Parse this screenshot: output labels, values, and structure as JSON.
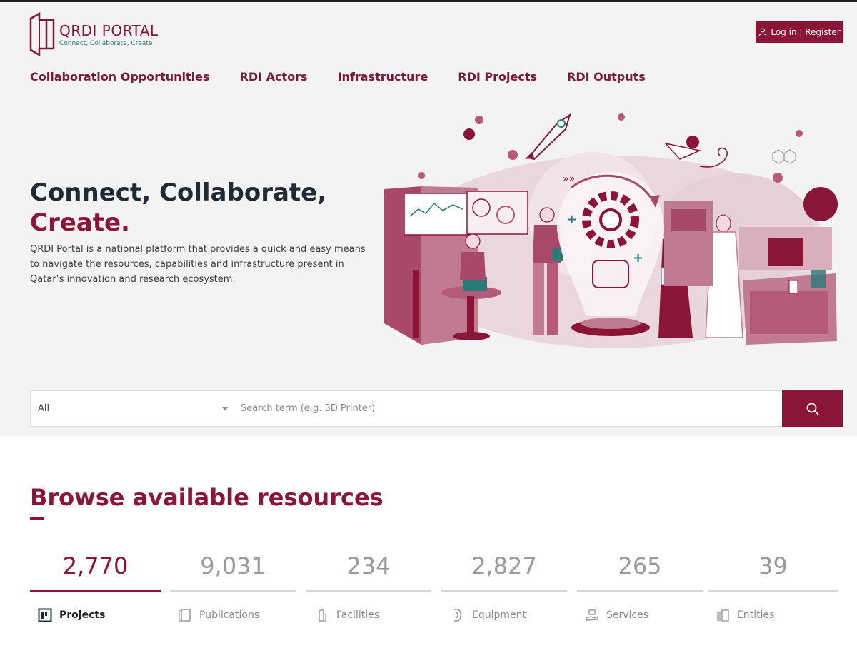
{
  "brand": {
    "title": "QRDI PORTAL",
    "tagline": "Connect, Collaborate, Create",
    "accent_color": "#8a1538",
    "tagline_color": "#2a7a7a"
  },
  "header": {
    "login_label": "Log in | Register",
    "login_icon": "user-icon"
  },
  "nav": {
    "items": [
      {
        "label": "Collaboration Opportunities"
      },
      {
        "label": "RDI Actors"
      },
      {
        "label": "Infrastructure"
      },
      {
        "label": "RDI Projects"
      },
      {
        "label": "RDI Outputs"
      }
    ]
  },
  "hero": {
    "title_line1": "Connect, Collaborate,",
    "title_line2": "Create.",
    "description": "QRDI Portal is a national platform that provides a quick and easy means to navigate the resources, capabilities and infrastructure present in Qatar’s innovation and research ecosystem."
  },
  "search": {
    "category_value": "All",
    "placeholder": "Search term (e.g. 3D Printer)",
    "button_icon": "search-icon"
  },
  "browse": {
    "title": "Browse available resources",
    "stats": [
      {
        "value": "2,770",
        "label": "Projects",
        "icon": "projects-icon",
        "active": true
      },
      {
        "value": "9,031",
        "label": "Publications",
        "icon": "publications-icon",
        "active": false
      },
      {
        "value": "234",
        "label": "Facilities",
        "icon": "facilities-icon",
        "active": false
      },
      {
        "value": "2,827",
        "label": "Equipment",
        "icon": "equipment-icon",
        "active": false
      },
      {
        "value": "265",
        "label": "Services",
        "icon": "services-icon",
        "active": false
      },
      {
        "value": "39",
        "label": "Entities",
        "icon": "entities-icon",
        "active": false
      }
    ]
  }
}
